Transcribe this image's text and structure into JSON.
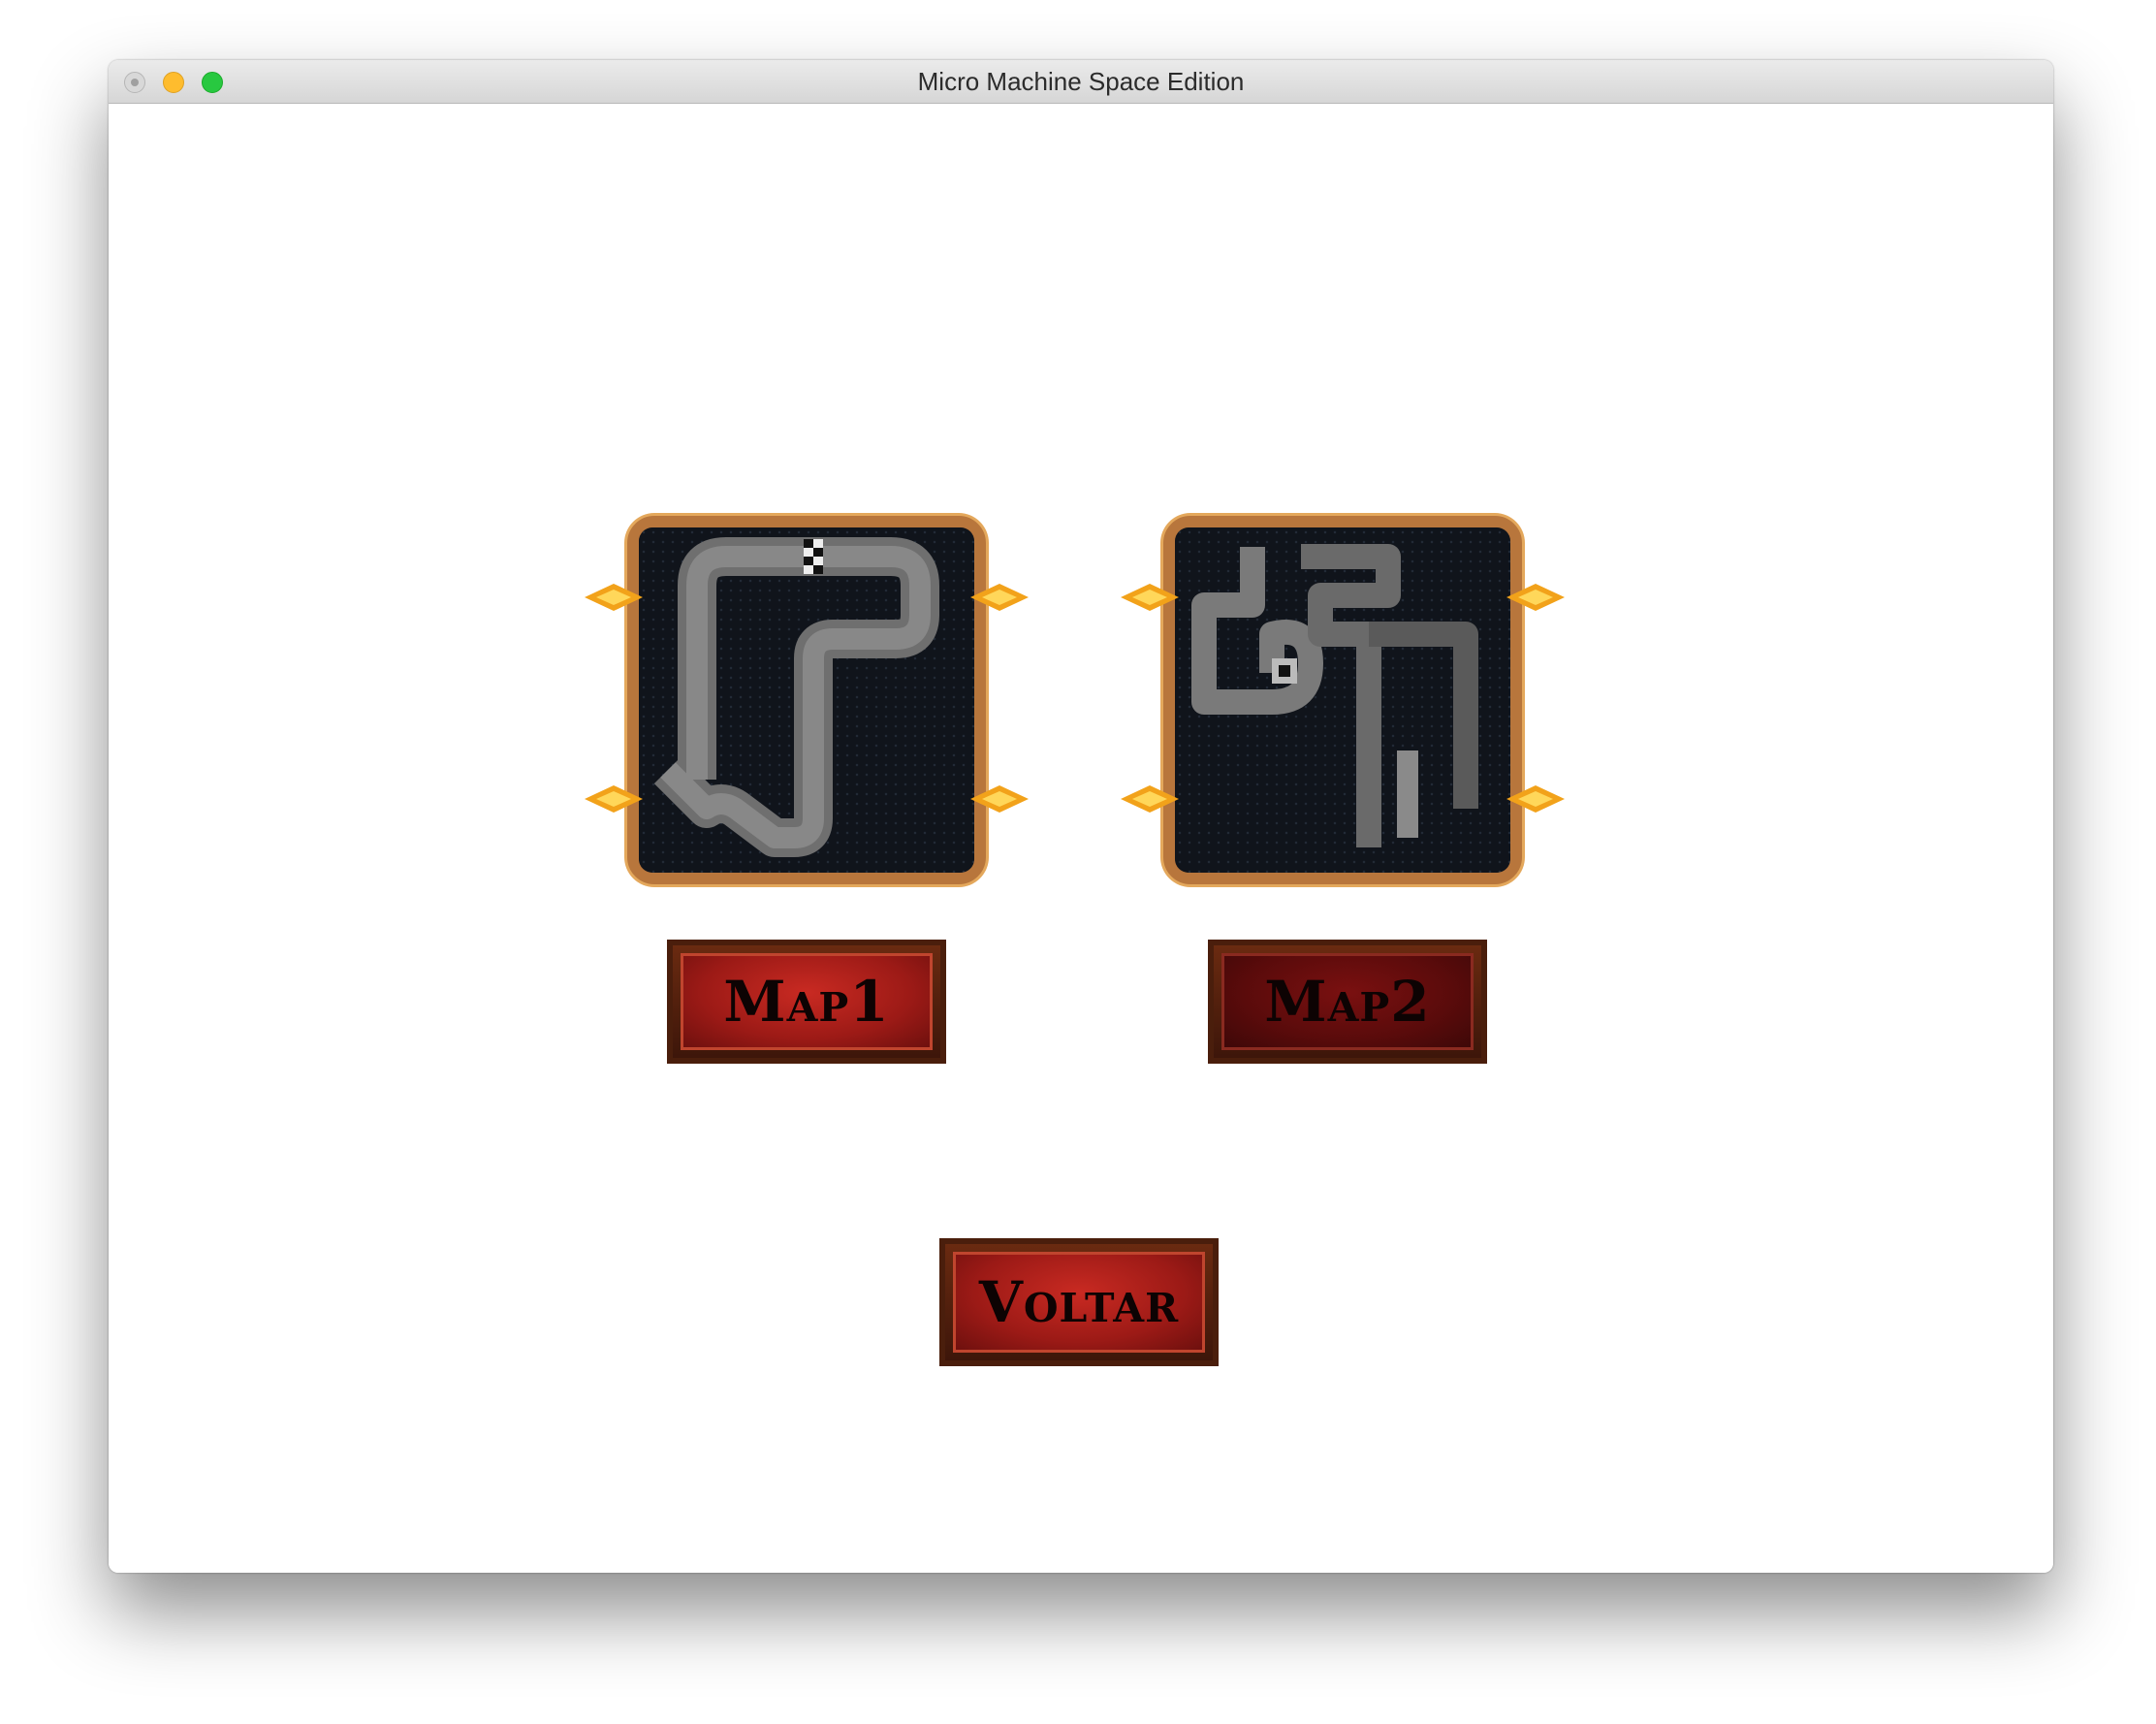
{
  "window": {
    "title": "Micro Machine Space Edition"
  },
  "maps": [
    {
      "name": "Map 1 preview",
      "button_label": "Map1"
    },
    {
      "name": "Map 2 preview",
      "button_label": "Map2"
    }
  ],
  "actions": {
    "back_label": "Voltar"
  },
  "colors": {
    "button_red": "#9c1a16",
    "frame_orange": "#b8763c",
    "track_bg": "#10141b"
  }
}
